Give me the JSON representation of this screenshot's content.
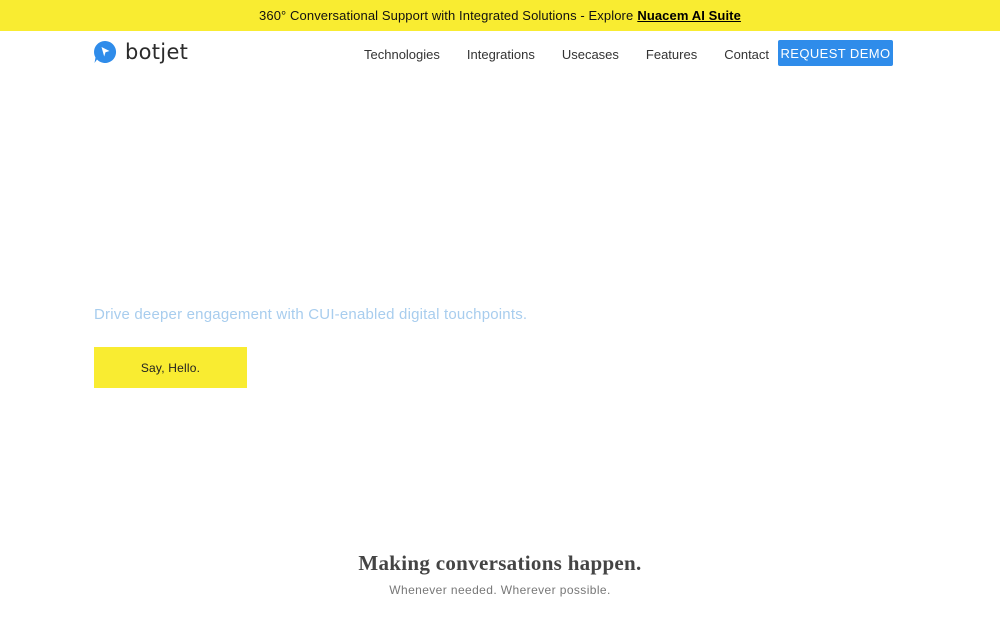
{
  "announcement": {
    "text": "360° Conversational Support with Integrated Solutions - Explore",
    "link_label": "Nuacem AI Suite"
  },
  "navbar": {
    "logo_text": "botjet",
    "logo_icon": "chat-bubble-cursor-icon",
    "links": [
      {
        "label": "Technologies"
      },
      {
        "label": "Integrations"
      },
      {
        "label": "Usecases"
      },
      {
        "label": "Features"
      },
      {
        "label": "Contact"
      }
    ],
    "cta_label": "REQUEST DEMO"
  },
  "hero": {
    "tagline": "Drive deeper engagement with CUI-enabled digital touchpoints.",
    "button_label": "Say, Hello."
  },
  "section": {
    "heading": "Making conversations happen.",
    "subheading": "Whenever needed. Wherever possible."
  },
  "colors": {
    "accent_yellow": "#f9ec31",
    "brand_blue": "#2f8cea",
    "tagline_blue": "#a8cdee"
  }
}
